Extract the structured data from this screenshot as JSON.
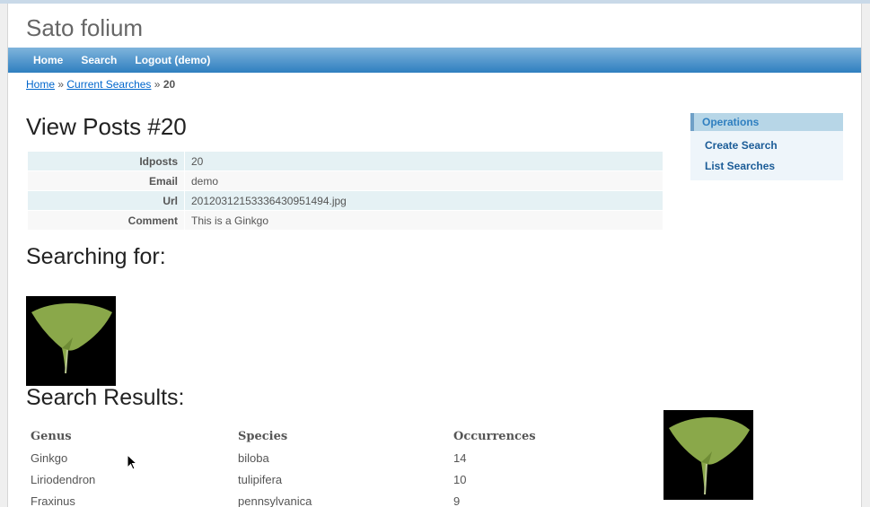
{
  "site": {
    "title": "Sato folium"
  },
  "menu": {
    "items": [
      {
        "label": "Home"
      },
      {
        "label": "Search"
      },
      {
        "label": "Logout (demo)"
      }
    ]
  },
  "breadcrumbs": {
    "home": "Home",
    "sep1": "»",
    "current_searches": "Current Searches",
    "sep2": "»",
    "current": "20"
  },
  "page": {
    "title": "View Posts #20"
  },
  "detail": {
    "rows": [
      {
        "label": "Idposts",
        "value": "20"
      },
      {
        "label": "Email",
        "value": "demo"
      },
      {
        "label": "Url",
        "value": "20120312153336430951494.jpg"
      },
      {
        "label": "Comment",
        "value": "This is a Ginkgo"
      }
    ]
  },
  "searching": {
    "heading": "Searching for:"
  },
  "results": {
    "heading": "Search Results:",
    "columns": [
      "Genus",
      "Species",
      "Occurrences"
    ],
    "rows": [
      {
        "genus": "Ginkgo",
        "species": "biloba",
        "occurrences": "14"
      },
      {
        "genus": "Liriodendron",
        "species": "tulipifera",
        "occurrences": "10"
      },
      {
        "genus": "Fraxinus",
        "species": "pennsylvanica",
        "occurrences": "9"
      }
    ]
  },
  "operations": {
    "title": "Operations",
    "items": [
      {
        "label": "Create Search"
      },
      {
        "label": "List Searches"
      }
    ]
  },
  "colors": {
    "menu_gradient_top": "#7fb4dc",
    "menu_gradient_bottom": "#2f7fc0",
    "link": "#0066cc",
    "leaf_green": "#8aa84a"
  },
  "icons": {
    "leaf_image": "ginkgo-leaf-image",
    "cursor": "mouse-pointer-icon"
  }
}
